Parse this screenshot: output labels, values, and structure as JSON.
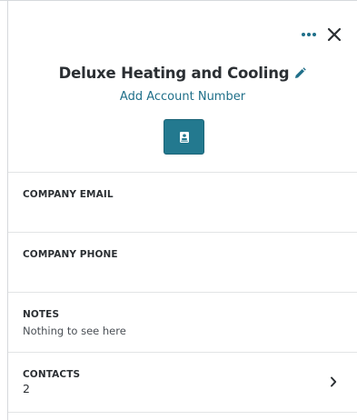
{
  "account": {
    "name": "Deluxe Heating and Cooling",
    "add_account_number_label": "Add Account Number"
  },
  "header": {
    "more_icon": "more-horizontal-icon",
    "close_icon": "close-icon",
    "edit_icon": "pencil-icon",
    "contact_card_icon": "contact-card-icon"
  },
  "sections": {
    "company_email": {
      "label": "COMPANY EMAIL",
      "value": ""
    },
    "company_phone": {
      "label": "COMPANY PHONE",
      "value": ""
    },
    "notes": {
      "label": "NOTES",
      "value": "Nothing to see here"
    },
    "contacts": {
      "label": "CONTACTS",
      "value": "2"
    }
  },
  "colors": {
    "accent": "#23798f",
    "link": "#1f6f89",
    "text": "#2b2f33",
    "divider": "#e2e4e6"
  }
}
